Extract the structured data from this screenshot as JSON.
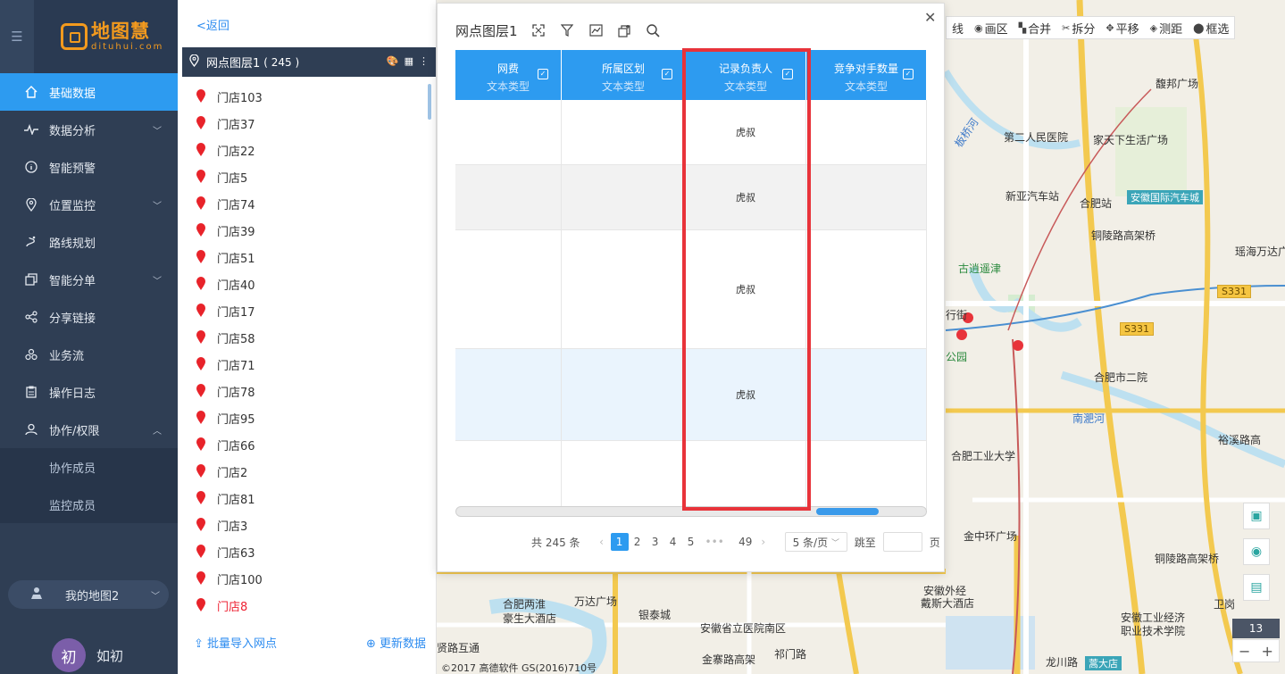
{
  "nav": {
    "logo_cn": "地图慧",
    "logo_en": "dituhui.com",
    "items": [
      {
        "label": "基础数据",
        "active": true
      },
      {
        "label": "数据分析",
        "caret": "down"
      },
      {
        "label": "智能预警"
      },
      {
        "label": "位置监控",
        "caret": "down"
      },
      {
        "label": "路线规划"
      },
      {
        "label": "智能分单",
        "caret": "down"
      },
      {
        "label": "分享链接"
      },
      {
        "label": "业务流"
      },
      {
        "label": "操作日志"
      },
      {
        "label": "协作/权限",
        "caret": "up"
      }
    ],
    "sub_items": [
      "协作成员",
      "监控成员"
    ],
    "my_map": "我的地图2",
    "user_initial": "初",
    "user_name": "如初"
  },
  "list_panel": {
    "back": "<返回",
    "layer_name": "网点图层1",
    "layer_count": "( 245 )",
    "shops": [
      "门店103",
      "门店37",
      "门店22",
      "门店5",
      "门店74",
      "门店39",
      "门店51",
      "门店40",
      "门店17",
      "门店58",
      "门店71",
      "门店78",
      "门店95",
      "门店66",
      "门店2",
      "门店81",
      "门店3",
      "门店63",
      "门店100",
      "门店8"
    ],
    "batch_import": "批量导入网点",
    "update_data": "更新数据"
  },
  "toolbar": [
    "线",
    "画区",
    "合并",
    "拆分",
    "平移",
    "测距",
    "框选"
  ],
  "map": {
    "labels": [
      "馥邦广场",
      "第二人民医院",
      "家天下生活广场",
      "新亚汽车站",
      "合肥站",
      "安徽国际汽车城",
      "铜陵路高架桥",
      "瑶海万达广",
      "古逍遥津",
      "行街",
      "公园",
      "S331",
      "S331",
      "合肥市二院",
      "南淝河",
      "合肥工业大学",
      "裕溪路高",
      "金中环广场",
      "铜陵路高架桥",
      "合肥两淮",
      "豪生大酒店",
      "万达广场",
      "银泰城",
      "安徽省立医院南区",
      "安徽外经",
      "戴斯大酒店",
      "安徽工业经济",
      "职业技术学院",
      "卫岗",
      "贤路互通",
      "金寨路高架",
      "祁门路",
      "龙川路",
      "蒿大店",
      "板桥河"
    ],
    "zoom": "13",
    "copyright": "©2017 高德软件 GS(2016)710号"
  },
  "dialog": {
    "title": "网点图层1",
    "columns": [
      {
        "name": "网费",
        "type": "文本类型"
      },
      {
        "name": "所属区划",
        "type": "文本类型"
      },
      {
        "name": "记录负责人",
        "type": "文本类型"
      },
      {
        "name": "竞争对手数量",
        "type": "文本类型"
      }
    ],
    "rows": [
      [
        "",
        "",
        "虎叔",
        ""
      ],
      [
        "",
        "",
        "虎叔",
        ""
      ],
      [
        "",
        "",
        "虎叔",
        ""
      ],
      [
        "",
        "",
        "虎叔",
        ""
      ],
      [
        "",
        "",
        "",
        ""
      ]
    ],
    "pager": {
      "total": "共 245 条",
      "pages": [
        "1",
        "2",
        "3",
        "4",
        "5",
        "•••",
        "49"
      ],
      "current": "1",
      "page_size": "5 条/页",
      "jump_label": "跳至",
      "page_suffix": "页"
    }
  },
  "colors": {
    "nav_bg": "#2f3e54",
    "accent": "#2d9bf0",
    "highlight": "#e8333a",
    "logo": "#f39a1e"
  }
}
